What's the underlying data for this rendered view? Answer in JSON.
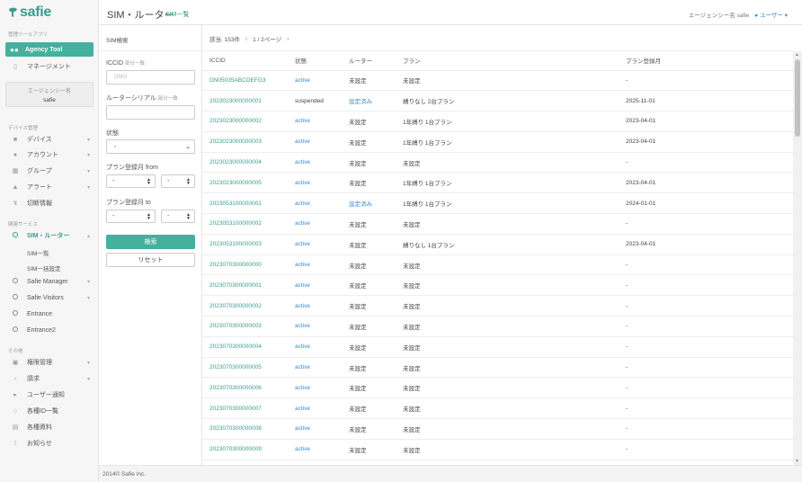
{
  "brand": {
    "logo_text": "safie",
    "accent": "#45b09d",
    "link": "#3a8ad0"
  },
  "sidebar": {
    "section_admin": "管理ツールアプリ",
    "agency_tool": "Agency Tool",
    "management": "マネージメント",
    "agency_box": {
      "title": "エージェンシー名",
      "value": "safie"
    },
    "section_device": "デバイス管理",
    "device_items": [
      {
        "label": "デバイス",
        "icon": "camera-icon",
        "has_chevron": true
      },
      {
        "label": "アカウント",
        "icon": "user-icon",
        "has_chevron": true
      },
      {
        "label": "グループ",
        "icon": "grid-icon",
        "has_chevron": true
      },
      {
        "label": "アラート",
        "icon": "bell-icon",
        "has_chevron": true
      },
      {
        "label": "切断情報",
        "icon": "bolt-icon",
        "has_chevron": false
      }
    ],
    "section_related": "関連サービス",
    "sim_router": "SIM・ルーター",
    "sim_list": "SIM一覧",
    "sim_bulk": "SIM一括設定",
    "related_items": [
      {
        "label": "Safie Manager",
        "has_chevron": true
      },
      {
        "label": "Safie Visitors",
        "has_chevron": true
      },
      {
        "label": "Entrance",
        "has_chevron": false
      },
      {
        "label": "Entrance2",
        "has_chevron": false
      }
    ],
    "section_other": "その他",
    "other_items": [
      {
        "label": "権限管理",
        "icon": "lock-icon",
        "has_chevron": true
      },
      {
        "label": "請求",
        "icon": "card-icon",
        "has_chevron": true
      },
      {
        "label": "ユーザー通知",
        "icon": "megaphone-icon",
        "has_chevron": false
      },
      {
        "label": "各種ID一覧",
        "icon": "search-icon",
        "has_chevron": false
      },
      {
        "label": "各種資料",
        "icon": "document-icon",
        "has_chevron": false
      },
      {
        "label": "お知らせ",
        "icon": "info-icon",
        "has_chevron": false
      }
    ]
  },
  "header": {
    "title": "SIM・ルーター",
    "subtitle": "SIM一覧",
    "agency_label": "エージェンシー名 safie",
    "user_label": "ユーザー"
  },
  "filter": {
    "title": "SIM検索",
    "iccid_label": "ICCID",
    "iccid_hint": "部分一致",
    "iccid_placeholder": "DMO",
    "router_label": "ルーターシリアル",
    "router_hint": "部分一致",
    "router_value": "",
    "status_label": "状態",
    "status_value": "-",
    "plan_from_label": "プラン登録月 from",
    "plan_to_label": "プラン登録月 to",
    "year_value": "-",
    "month_value": "-",
    "search_button": "検索",
    "reset_button": "リセット"
  },
  "pager": {
    "count": "該当: 153件",
    "page": "1 / 2ページ"
  },
  "table": {
    "columns": [
      "ICCID",
      "状態",
      "ルーター",
      "プラン",
      "プラン登録月"
    ],
    "rows": [
      {
        "iccid": "DN05035ABCDEFG3",
        "status": "active",
        "router": "未設定",
        "plan": "未設定",
        "month": "-"
      },
      {
        "iccid": "2023023000000001",
        "status": "suspended",
        "router": "設定済み",
        "plan": "縛りなし 2台プラン",
        "month": "2025-11-01"
      },
      {
        "iccid": "2023023000000002",
        "status": "active",
        "router": "未設定",
        "plan": "1年縛り 1台プラン",
        "month": "2023-04-01"
      },
      {
        "iccid": "2023023000000003",
        "status": "active",
        "router": "未設定",
        "plan": "1年縛り 1台プラン",
        "month": "2023-04-01"
      },
      {
        "iccid": "2023023000000004",
        "status": "active",
        "router": "未設定",
        "plan": "未設定",
        "month": "-"
      },
      {
        "iccid": "2023023000000005",
        "status": "active",
        "router": "未設定",
        "plan": "1年縛り 1台プラン",
        "month": "2023-04-01"
      },
      {
        "iccid": "2023053100000001",
        "status": "active",
        "router": "設定済み",
        "plan": "1年縛り 1台プラン",
        "month": "2024-01-01"
      },
      {
        "iccid": "2023053100000002",
        "status": "active",
        "router": "未設定",
        "plan": "未設定",
        "month": "-"
      },
      {
        "iccid": "2023053100000003",
        "status": "active",
        "router": "未設定",
        "plan": "縛りなし 1台プラン",
        "month": "2023-04-01"
      },
      {
        "iccid": "2023070300000000",
        "status": "active",
        "router": "未設定",
        "plan": "未設定",
        "month": "-"
      },
      {
        "iccid": "2023070300000001",
        "status": "active",
        "router": "未設定",
        "plan": "未設定",
        "month": "-"
      },
      {
        "iccid": "2023070300000002",
        "status": "active",
        "router": "未設定",
        "plan": "未設定",
        "month": "-"
      },
      {
        "iccid": "2023070300000003",
        "status": "active",
        "router": "未設定",
        "plan": "未設定",
        "month": "-"
      },
      {
        "iccid": "2023070300000004",
        "status": "active",
        "router": "未設定",
        "plan": "未設定",
        "month": "-"
      },
      {
        "iccid": "2023070300000005",
        "status": "active",
        "router": "未設定",
        "plan": "未設定",
        "month": "-"
      },
      {
        "iccid": "2023070300000006",
        "status": "active",
        "router": "未設定",
        "plan": "未設定",
        "month": "-"
      },
      {
        "iccid": "2023070300000007",
        "status": "active",
        "router": "未設定",
        "plan": "未設定",
        "month": "-"
      },
      {
        "iccid": "2023070300000008",
        "status": "active",
        "router": "未設定",
        "plan": "未設定",
        "month": "-"
      },
      {
        "iccid": "2023070300000009",
        "status": "active",
        "router": "未設定",
        "plan": "未設定",
        "month": "-"
      }
    ]
  },
  "footer": {
    "copyright": "2014© Safie Inc."
  }
}
